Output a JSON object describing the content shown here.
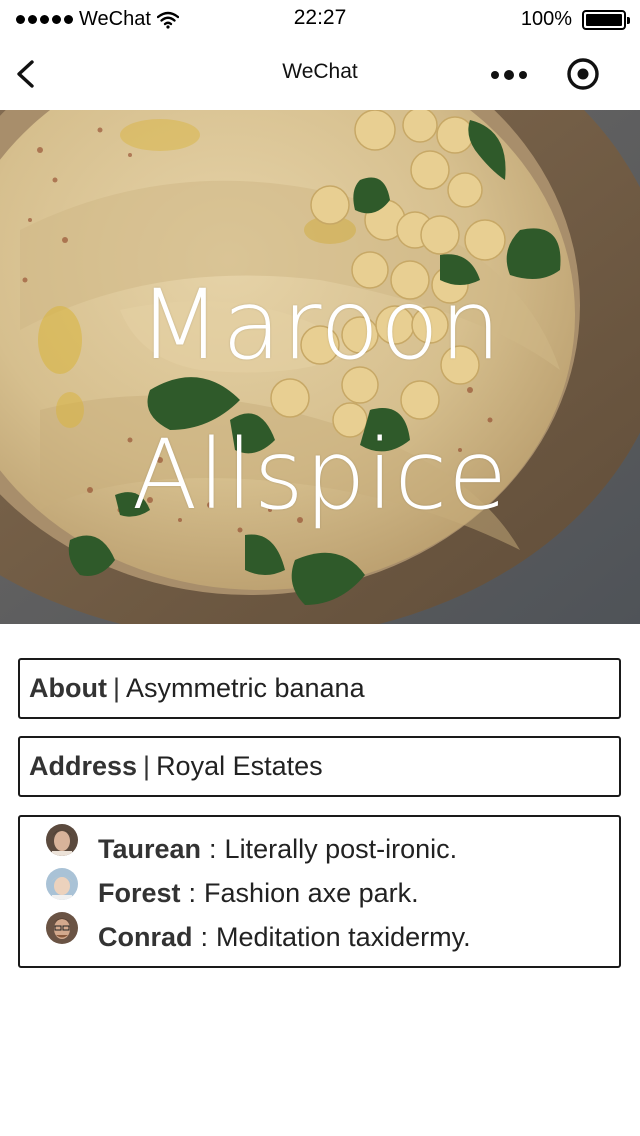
{
  "status_bar": {
    "carrier": "WeChat",
    "time": "22:27",
    "battery_percent": "100%",
    "signal_dots": 5,
    "icons": [
      "signal-dots-icon",
      "wifi-icon",
      "battery-icon"
    ]
  },
  "nav": {
    "title": "WeChat",
    "icons": [
      "back-chevron-icon",
      "more-dots-icon",
      "record-circle-icon"
    ]
  },
  "hero": {
    "title_line1": "Maroon",
    "title_line2": "Allspice"
  },
  "about": {
    "label": "About",
    "separator": "|",
    "value": "Asymmetric banana"
  },
  "address": {
    "label": "Address",
    "separator": "|",
    "value": "Royal Estates"
  },
  "reviews": [
    {
      "name": "Taurean",
      "colon": ":",
      "text": "Literally post-ironic."
    },
    {
      "name": "Forest",
      "colon": ":",
      "text": "Fashion axe park."
    },
    {
      "name": "Conrad",
      "colon": ":",
      "text": "Meditation taxidermy."
    }
  ],
  "colors": {
    "border": "#1a1a1a",
    "hero_title": "#ffffff",
    "background": "#ffffff"
  }
}
